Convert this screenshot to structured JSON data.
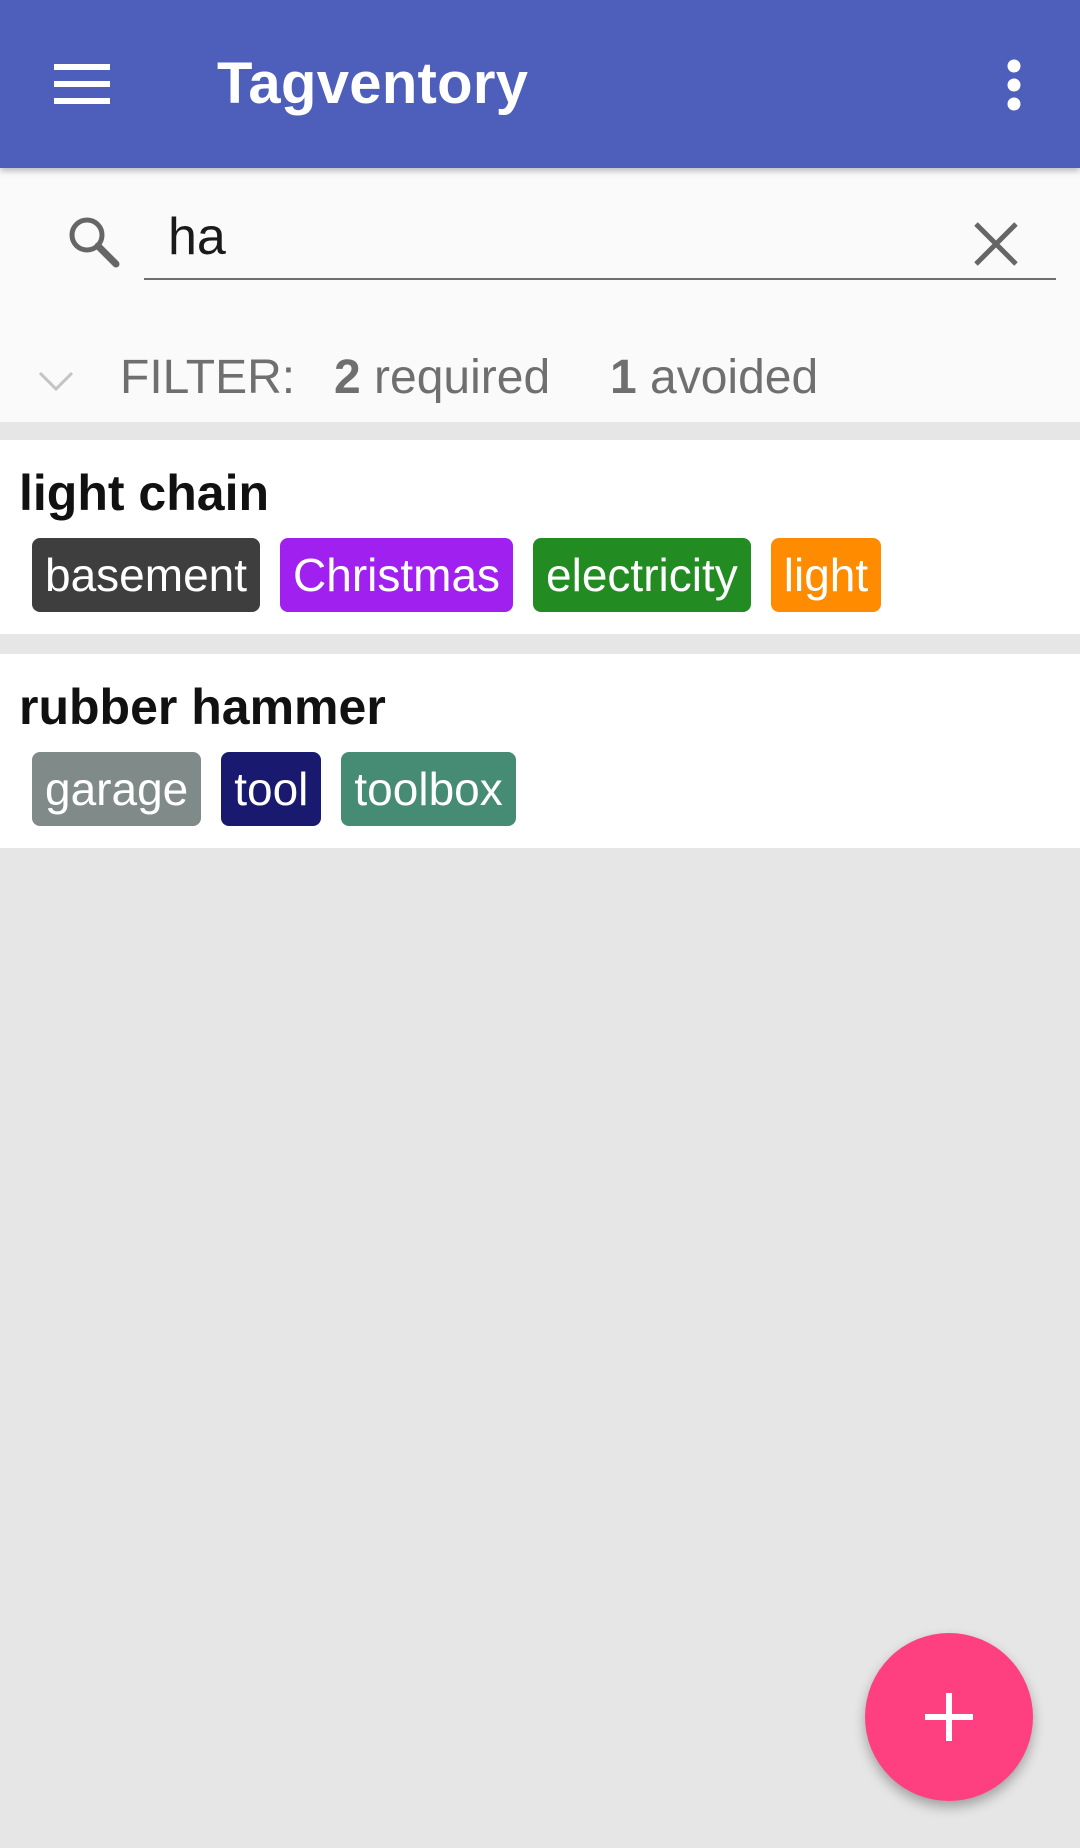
{
  "app_bar": {
    "title": "Tagventory",
    "menu_icon": "hamburger-menu-icon",
    "overflow_icon": "more-vert-icon",
    "background": "#4d5fbb"
  },
  "search": {
    "value": "ha",
    "icon": "search-icon",
    "clear_icon": "close-icon"
  },
  "filter": {
    "label": "FILTER:",
    "required_count": "2",
    "required_label": " required",
    "avoided_count": "1",
    "avoided_label": " avoided",
    "expand_icon": "chevron-down-icon"
  },
  "items": [
    {
      "name": "light chain",
      "tags": [
        {
          "label": "basement",
          "color": "#3e3e3e"
        },
        {
          "label": "Christmas",
          "color": "#a020f0"
        },
        {
          "label": "electricity",
          "color": "#228b22"
        },
        {
          "label": "light",
          "color": "#ff8c00"
        }
      ]
    },
    {
      "name": "rubber hammer",
      "tags": [
        {
          "label": "garage",
          "color": "#808a88"
        },
        {
          "label": "tool",
          "color": "#191970"
        },
        {
          "label": "toolbox",
          "color": "#468b74"
        }
      ]
    }
  ],
  "fab": {
    "icon": "plus-icon",
    "color": "#fe4081"
  }
}
